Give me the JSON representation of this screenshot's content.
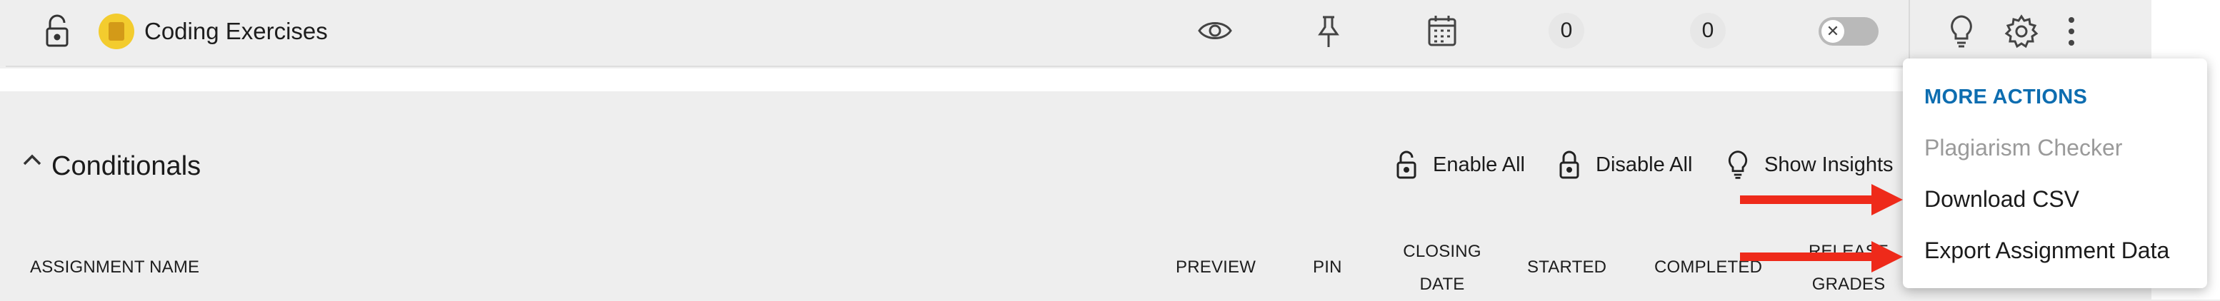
{
  "assignment_row": {
    "title": "Coding Exercises",
    "started_count": "0",
    "completed_count": "0",
    "toggle_state": "off",
    "icons": [
      "lock-icon",
      "calculator-icon",
      "eye-icon",
      "pin-icon",
      "calendar-icon",
      "x-icon",
      "lightbulb-icon",
      "gear-icon",
      "kebab-icon"
    ]
  },
  "section": {
    "title": "Conditionals",
    "actions": {
      "enable_all": "Enable All",
      "disable_all": "Disable All",
      "show_insights": "Show Insights"
    },
    "columns": {
      "assignment_name": "ASSIGNMENT NAME",
      "preview": "PREVIEW",
      "pin": "PIN",
      "closing_date_line1": "CLOSING",
      "closing_date_line2": "DATE",
      "started": "STARTED",
      "completed": "COMPLETED",
      "release_grades_line1": "RELEASE",
      "release_grades_line2": "GRADES"
    }
  },
  "menu": {
    "heading": "MORE ACTIONS",
    "items": [
      {
        "label": "Plagiarism Checker",
        "enabled": false
      },
      {
        "label": "Download CSV",
        "enabled": true
      },
      {
        "label": "Export Assignment Data",
        "enabled": true
      }
    ]
  },
  "colors": {
    "accent": "#0d6db0",
    "annotation_arrow": "#ee2a1a",
    "coin": "#f3cc2e"
  }
}
